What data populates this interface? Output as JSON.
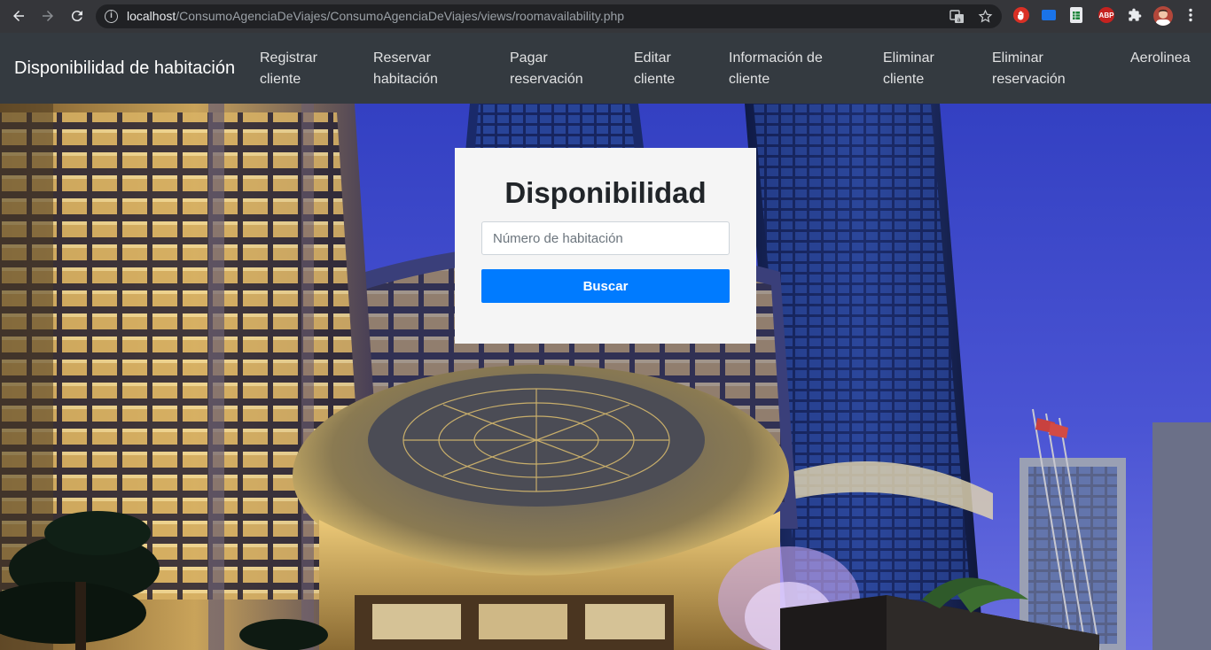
{
  "browser": {
    "url_host": "localhost",
    "url_path": "/ConsumoAgenciaDeViajes/ConsumoAgenciaDeViajes/views/roomavailability.php",
    "extensions": [
      "adblock-icon",
      "cast-icon",
      "sheets-icon",
      "abp-icon",
      "puzzle-icon",
      "profile-avatar",
      "more-menu-icon"
    ],
    "abp_label": "ABP"
  },
  "navbar": {
    "brand": "Disponibilidad de habitación",
    "links": [
      {
        "line1": "Registrar",
        "line2": "cliente"
      },
      {
        "line1": "Reservar",
        "line2": "habitación"
      },
      {
        "line1": "Pagar",
        "line2": "reservación"
      },
      {
        "line1": "Editar",
        "line2": "cliente"
      },
      {
        "line1": "Información de",
        "line2": "cliente"
      },
      {
        "line1": "Eliminar",
        "line2": "cliente"
      },
      {
        "line1": "Eliminar",
        "line2": "reservación"
      },
      {
        "line1": "Aerolinea",
        "line2": ""
      }
    ]
  },
  "card": {
    "title": "Disponibilidad",
    "input_placeholder": "Número de habitación",
    "input_value": "",
    "button_label": "Buscar"
  },
  "colors": {
    "navbar_bg": "#343a40",
    "button_primary": "#007bff",
    "card_bg": "#f5f5f5"
  }
}
